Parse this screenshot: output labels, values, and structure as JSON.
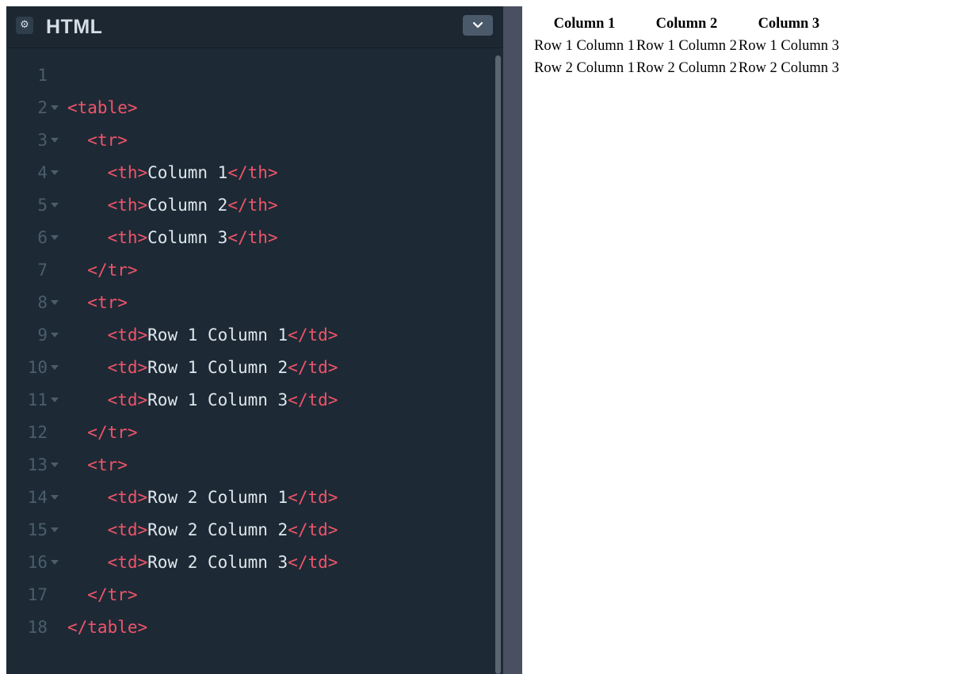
{
  "editor": {
    "title": "HTML",
    "header_icon": "gear-icon",
    "collapse_icon": "chevron-down-icon",
    "lines": [
      {
        "num": "1",
        "fold": false,
        "tokens": []
      },
      {
        "num": "2",
        "fold": true,
        "tokens": [
          {
            "t": "tag",
            "v": "<table>"
          }
        ]
      },
      {
        "num": "3",
        "fold": true,
        "tokens": [
          {
            "t": "txt",
            "v": "  "
          },
          {
            "t": "tag",
            "v": "<tr>"
          }
        ]
      },
      {
        "num": "4",
        "fold": true,
        "tokens": [
          {
            "t": "txt",
            "v": "    "
          },
          {
            "t": "tag",
            "v": "<th>"
          },
          {
            "t": "txt",
            "v": "Column 1"
          },
          {
            "t": "tag",
            "v": "</th>"
          }
        ]
      },
      {
        "num": "5",
        "fold": true,
        "tokens": [
          {
            "t": "txt",
            "v": "    "
          },
          {
            "t": "tag",
            "v": "<th>"
          },
          {
            "t": "txt",
            "v": "Column 2"
          },
          {
            "t": "tag",
            "v": "</th>"
          }
        ]
      },
      {
        "num": "6",
        "fold": true,
        "tokens": [
          {
            "t": "txt",
            "v": "    "
          },
          {
            "t": "tag",
            "v": "<th>"
          },
          {
            "t": "txt",
            "v": "Column 3"
          },
          {
            "t": "tag",
            "v": "</th>"
          }
        ]
      },
      {
        "num": "7",
        "fold": false,
        "tokens": [
          {
            "t": "txt",
            "v": "  "
          },
          {
            "t": "tag",
            "v": "</tr>"
          }
        ]
      },
      {
        "num": "8",
        "fold": true,
        "tokens": [
          {
            "t": "txt",
            "v": "  "
          },
          {
            "t": "tag",
            "v": "<tr>"
          }
        ]
      },
      {
        "num": "9",
        "fold": true,
        "tokens": [
          {
            "t": "txt",
            "v": "    "
          },
          {
            "t": "tag",
            "v": "<td>"
          },
          {
            "t": "txt",
            "v": "Row 1 Column 1"
          },
          {
            "t": "tag",
            "v": "</td>"
          }
        ]
      },
      {
        "num": "10",
        "fold": true,
        "tokens": [
          {
            "t": "txt",
            "v": "    "
          },
          {
            "t": "tag",
            "v": "<td>"
          },
          {
            "t": "txt",
            "v": "Row 1 Column 2"
          },
          {
            "t": "tag",
            "v": "</td>"
          }
        ]
      },
      {
        "num": "11",
        "fold": true,
        "tokens": [
          {
            "t": "txt",
            "v": "    "
          },
          {
            "t": "tag",
            "v": "<td>"
          },
          {
            "t": "txt",
            "v": "Row 1 Column 3"
          },
          {
            "t": "tag",
            "v": "</td>"
          }
        ]
      },
      {
        "num": "12",
        "fold": false,
        "tokens": [
          {
            "t": "txt",
            "v": "  "
          },
          {
            "t": "tag",
            "v": "</tr>"
          }
        ]
      },
      {
        "num": "13",
        "fold": true,
        "tokens": [
          {
            "t": "txt",
            "v": "  "
          },
          {
            "t": "tag",
            "v": "<tr>"
          }
        ]
      },
      {
        "num": "14",
        "fold": true,
        "tokens": [
          {
            "t": "txt",
            "v": "    "
          },
          {
            "t": "tag",
            "v": "<td>"
          },
          {
            "t": "txt",
            "v": "Row 2 Column 1"
          },
          {
            "t": "tag",
            "v": "</td>"
          }
        ]
      },
      {
        "num": "15",
        "fold": true,
        "tokens": [
          {
            "t": "txt",
            "v": "    "
          },
          {
            "t": "tag",
            "v": "<td>"
          },
          {
            "t": "txt",
            "v": "Row 2 Column 2"
          },
          {
            "t": "tag",
            "v": "</td>"
          }
        ]
      },
      {
        "num": "16",
        "fold": true,
        "tokens": [
          {
            "t": "txt",
            "v": "    "
          },
          {
            "t": "tag",
            "v": "<td>"
          },
          {
            "t": "txt",
            "v": "Row 2 Column 3"
          },
          {
            "t": "tag",
            "v": "</td>"
          }
        ]
      },
      {
        "num": "17",
        "fold": false,
        "tokens": [
          {
            "t": "txt",
            "v": "  "
          },
          {
            "t": "tag",
            "v": "</tr>"
          }
        ]
      },
      {
        "num": "18",
        "fold": false,
        "tokens": [
          {
            "t": "tag",
            "v": "</table>"
          }
        ]
      }
    ]
  },
  "preview": {
    "headers": [
      "Column 1",
      "Column 2",
      "Column 3"
    ],
    "rows": [
      [
        "Row 1 Column 1",
        "Row 1 Column 2",
        "Row 1 Column 3"
      ],
      [
        "Row 2 Column 1",
        "Row 2 Column 2",
        "Row 2 Column 3"
      ]
    ]
  },
  "colors": {
    "editor_bg": "#1d2a35",
    "tag": "#f0546a",
    "text": "#dfe6ec",
    "gutter": "#4b5d6b",
    "divider": "#4a4f61"
  }
}
